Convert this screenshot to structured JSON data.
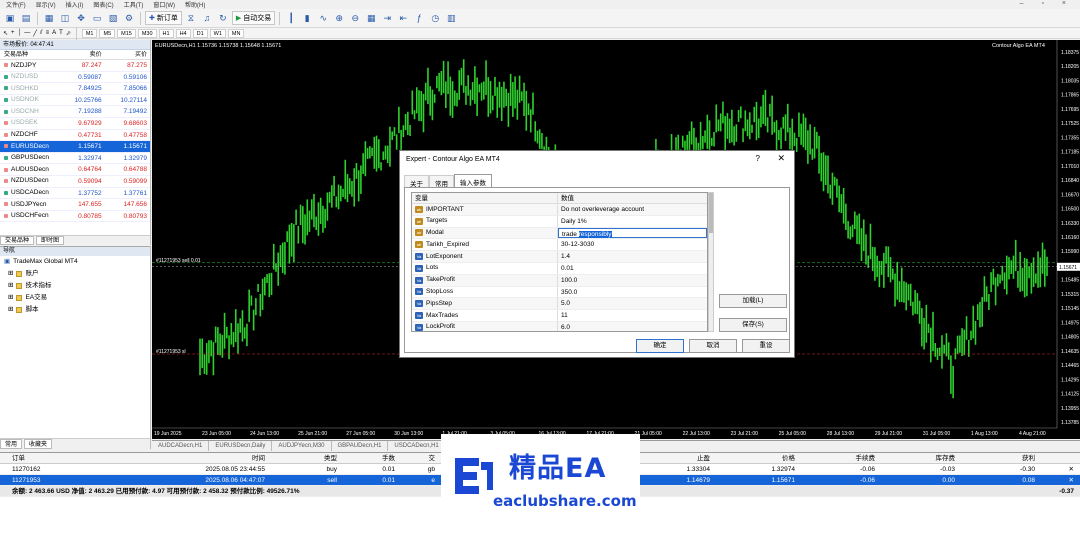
{
  "menu": [
    "文件(F)",
    "显示(V)",
    "插入(I)",
    "图表(C)",
    "工具(T)",
    "窗口(W)",
    "帮助(H)"
  ],
  "toolbar": {
    "new_order": "新订单",
    "auto_trade": "自动交易"
  },
  "timeframes": [
    "M1",
    "M5",
    "M15",
    "M30",
    "H1",
    "H4",
    "D1",
    "W1",
    "MN"
  ],
  "market_watch": {
    "title": "市场报价: 04:47:41",
    "headers": [
      "交易品种",
      "卖价",
      "买价"
    ],
    "rows": [
      {
        "sym": "NZDJPY",
        "bid": "87.247",
        "ask": "87.275",
        "style": "red"
      },
      {
        "sym": "NZDUSD",
        "bid": "0.59087",
        "ask": "0.59106",
        "style": "blue"
      },
      {
        "sym": "USDHKD",
        "bid": "7.84925",
        "ask": "7.85066",
        "style": "blue"
      },
      {
        "sym": "USDNOK",
        "bid": "10.25766",
        "ask": "10.27114",
        "style": "blue"
      },
      {
        "sym": "USDCNH",
        "bid": "7.19288",
        "ask": "7.19492",
        "style": "blue"
      },
      {
        "sym": "USDSEK",
        "bid": "9.67929",
        "ask": "9.68603",
        "style": "red"
      },
      {
        "sym": "NZDCHF",
        "bid": "0.47731",
        "ask": "0.47758",
        "style": "red"
      },
      {
        "sym": "EURUSDecn",
        "bid": "1.15671",
        "ask": "1.15671",
        "style": "sel"
      },
      {
        "sym": "GBPUSDecn",
        "bid": "1.32974",
        "ask": "1.32979",
        "style": "blue"
      },
      {
        "sym": "AUDUSDecn",
        "bid": "0.64764",
        "ask": "0.64788",
        "style": "red"
      },
      {
        "sym": "NZDUSDecn",
        "bid": "0.59094",
        "ask": "0.59099",
        "style": "red"
      },
      {
        "sym": "USDCADecn",
        "bid": "1.37752",
        "ask": "1.37761",
        "style": "blue"
      },
      {
        "sym": "USDJPYecn",
        "bid": "147.655",
        "ask": "147.656",
        "style": "red"
      },
      {
        "sym": "USDCHFecn",
        "bid": "0.80785",
        "ask": "0.80793",
        "style": "red"
      }
    ],
    "tabs": [
      "交易品种",
      "即时图"
    ]
  },
  "navigator": {
    "title": "导航",
    "root": "TradeMax Global MT4",
    "items": [
      "账户",
      "技术指标",
      "EA交易",
      "脚本"
    ],
    "tabs": [
      "常用",
      "收藏夹"
    ]
  },
  "chart": {
    "title": "EURUSDecn,H1  1.15736 1.15738 1.15648 1.15671",
    "ea": "Contour Algo EA MT4",
    "order_lines": [
      "#11271953 sell 0.01",
      "#11271953 sl"
    ],
    "price_tag": "1.15671",
    "y_ticks": [
      "1.18375",
      "1.18205",
      "1.18035",
      "1.17865",
      "1.17695",
      "1.17525",
      "1.17355",
      "1.17185",
      "1.17010",
      "1.16840",
      "1.16670",
      "1.16500",
      "1.16330",
      "1.16160",
      "1.15990",
      "1.15820",
      "1.15485",
      "1.15315",
      "1.15145",
      "1.14975",
      "1.14805",
      "1.14635",
      "1.14465",
      "1.14295",
      "1.14125",
      "1.13955",
      "1.13785"
    ],
    "x_ticks": [
      "19 Jun 2025",
      "23 Jun 05:00",
      "24 Jun 13:00",
      "25 Jun 21:00",
      "27 Jun 05:00",
      "30 Jun 13:00",
      "1 Jul 21:00",
      "3 Jul 05:00",
      "16 Jul 13:00",
      "17 Jul 21:00",
      "21 Jul 05:00",
      "22 Jul 13:00",
      "23 Jul 21:00",
      "25 Jul 05:00",
      "28 Jul 13:00",
      "29 Jul 21:00",
      "31 Jul 05:00",
      "1 Aug 13:00",
      "4 Aug 21:00"
    ],
    "tabs": [
      "AUDCADecn,H1",
      "EURUSDecn,Daily",
      "AUDJPYecn,M30",
      "GBPAUDecn,H1",
      "USDCADecn,H1"
    ]
  },
  "chart_data": {
    "type": "line",
    "title": "EURUSDecn,H1",
    "xlabel": "",
    "ylabel": "",
    "ylim": [
      1.13785,
      1.18375
    ],
    "x": [
      "19 Jun",
      "23 Jun",
      "24 Jun",
      "25 Jun",
      "27 Jun",
      "30 Jun",
      "1 Jul",
      "3 Jul",
      "16 Jul",
      "17 Jul",
      "21 Jul",
      "22 Jul",
      "23 Jul",
      "25 Jul",
      "28 Jul",
      "29 Jul",
      "31 Jul",
      "1 Aug",
      "4 Aug"
    ],
    "series": [
      {
        "values": [
          1.1455,
          1.1498,
          1.1612,
          1.1659,
          1.1718,
          1.179,
          1.1795,
          1.1768,
          1.1628,
          1.1655,
          1.17,
          1.1745,
          1.175,
          1.1722,
          1.16,
          1.154,
          1.144,
          1.1565,
          1.1567
        ]
      }
    ]
  },
  "dialog": {
    "title": "Expert - Contour Algo EA MT4",
    "tabs": [
      "关于",
      "常用",
      "输入参数"
    ],
    "headers": [
      "变量",
      "数值"
    ],
    "params": [
      {
        "icon": "ab",
        "name": "IMPORTANT",
        "value": "Do not overleverage account"
      },
      {
        "icon": "ab",
        "name": "Targets",
        "value": "Daily 1%"
      },
      {
        "icon": "ab",
        "name": "Modal",
        "value": "trade",
        "value_sel": "responsibly"
      },
      {
        "icon": "ab",
        "name": "Tarikh_Expired",
        "value": "30-12-3030"
      },
      {
        "icon": "v",
        "name": "LotExponent",
        "value": "1.4"
      },
      {
        "icon": "v",
        "name": "Lots",
        "value": "0.01"
      },
      {
        "icon": "v",
        "name": "TakeProfit",
        "value": "100.0"
      },
      {
        "icon": "v",
        "name": "StopLoss",
        "value": "350.0"
      },
      {
        "icon": "v",
        "name": "PipsStep",
        "value": "5.0"
      },
      {
        "icon": "v",
        "name": "MaxTrades",
        "value": "11"
      },
      {
        "icon": "v",
        "name": "LockProfit",
        "value": "6.0"
      }
    ],
    "load": "加载(L)",
    "save": "保存(S)",
    "ok": "确定",
    "cancel": "取消",
    "reset": "重设"
  },
  "orders": {
    "headers": [
      "订单",
      "时间",
      "类型",
      "手数",
      "交",
      "止盈",
      "价格",
      "手续费",
      "库存费",
      "获利"
    ],
    "rows": [
      {
        "id": "11270162",
        "time": "2025.08.05 23:44:55",
        "type": "buy",
        "lots": "0.01",
        "sym": "gb",
        "tp": "1.33304",
        "price": "1.32974",
        "comm": "-0.06",
        "swap": "-0.03",
        "profit": "-0.30"
      },
      {
        "id": "11271953",
        "time": "2025.08.06 04:47:07",
        "type": "sell",
        "lots": "0.01",
        "sym": "e",
        "tp": "1.14679",
        "price": "1.15671",
        "comm": "-0.06",
        "swap": "0.00",
        "profit": "0.08"
      }
    ],
    "summary": "余额: 2 463.66 USD  净值: 2 463.29  已用预付款: 4.97  可用预付款: 2 458.32  预付款比例: 49526.71%",
    "summary_profit": "-0.37"
  },
  "watermark": {
    "line1": "精品EA",
    "line2": "eaclubshare.com"
  }
}
